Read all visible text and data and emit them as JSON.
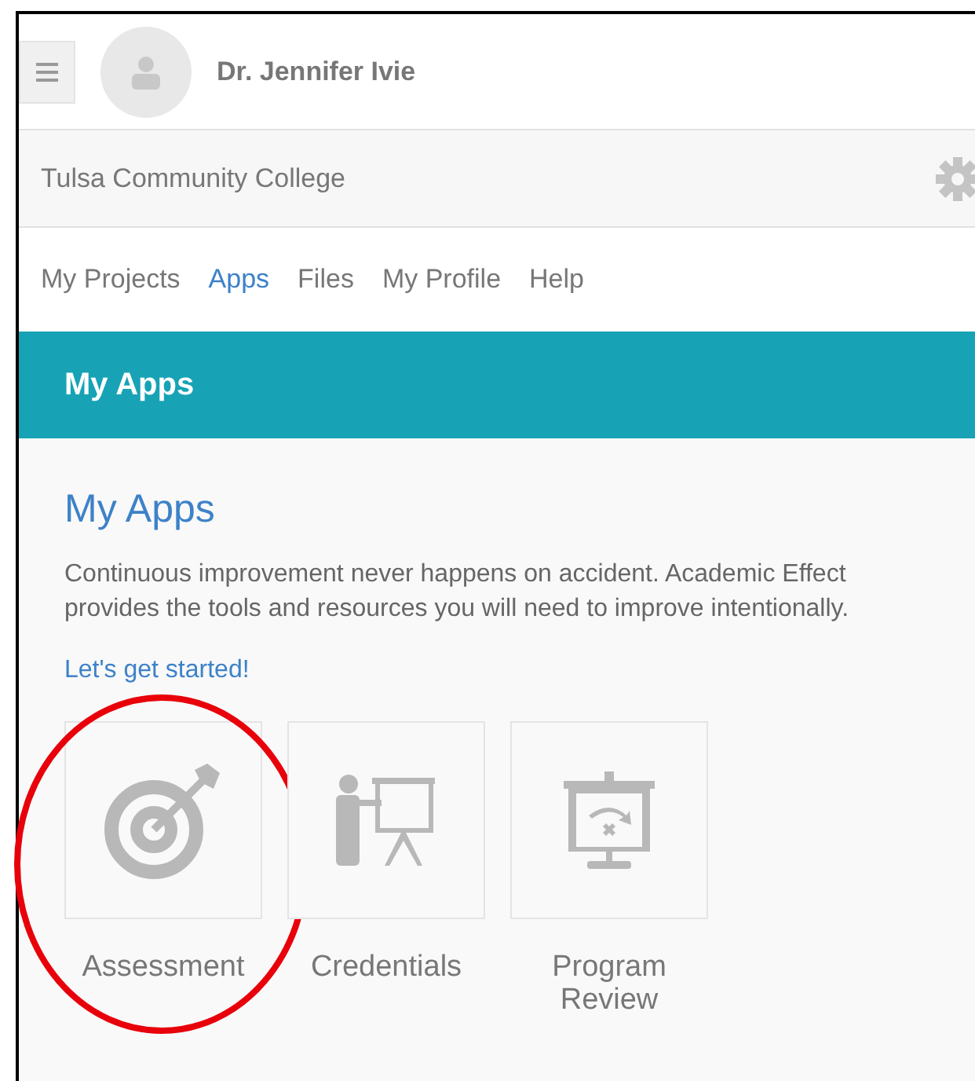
{
  "header": {
    "user_name": "Dr. Jennifer Ivie"
  },
  "org_bar": {
    "name": "Tulsa Community College"
  },
  "nav": [
    {
      "label": "My Projects",
      "selected": false
    },
    {
      "label": "Apps",
      "selected": true
    },
    {
      "label": "Files",
      "selected": false
    },
    {
      "label": "My Profile",
      "selected": false
    },
    {
      "label": "Help",
      "selected": false
    }
  ],
  "banner": {
    "title": "My Apps"
  },
  "content": {
    "heading": "My Apps",
    "description": "Continuous improvement never happens on accident. Academic Effect provides the tools and resources you will need to improve intentionally.",
    "link": "Let's get started!"
  },
  "apps": [
    {
      "kind": "target",
      "label": "Assessment",
      "circled": true
    },
    {
      "kind": "presenter",
      "label": "Credentials",
      "circled": false
    },
    {
      "kind": "board",
      "label": "Program Review",
      "circled": false
    }
  ]
}
